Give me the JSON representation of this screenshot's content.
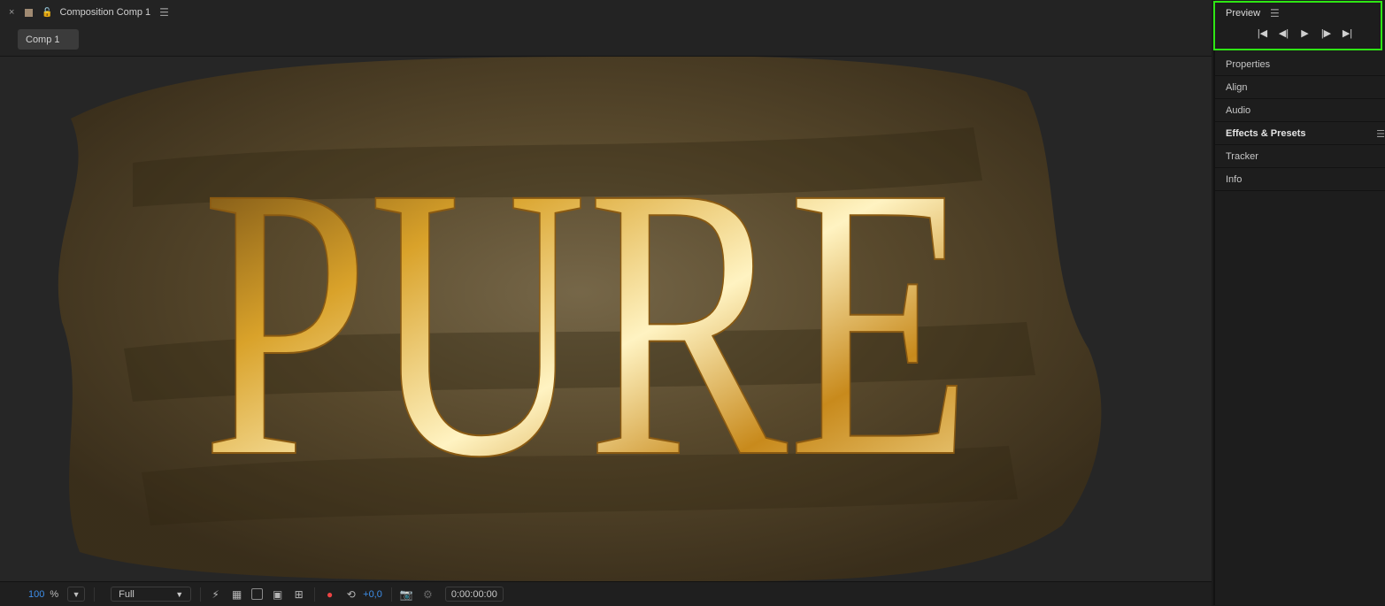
{
  "composition_panel": {
    "close_icon": "×",
    "title": "Composition Comp 1",
    "tab_label": "Comp 1",
    "canvas_text": "PURE"
  },
  "viewer_controls": {
    "zoom_value": "100",
    "zoom_unit": "%",
    "resolution": "Full",
    "exposure": "+0,0",
    "timecode": "0:00:00:00"
  },
  "preview_panel": {
    "title": "Preview",
    "controls": [
      "first-frame",
      "previous-frame",
      "play",
      "next-frame",
      "last-frame"
    ]
  },
  "right_panels": [
    {
      "label": "Properties"
    },
    {
      "label": "Align"
    },
    {
      "label": "Audio"
    },
    {
      "label": "Effects & Presets"
    },
    {
      "label": "Tracker"
    },
    {
      "label": "Info"
    }
  ],
  "colors": {
    "accent_blue": "#3d8ee9",
    "highlight_green": "#2ee614",
    "gold": "#d9a22a"
  }
}
